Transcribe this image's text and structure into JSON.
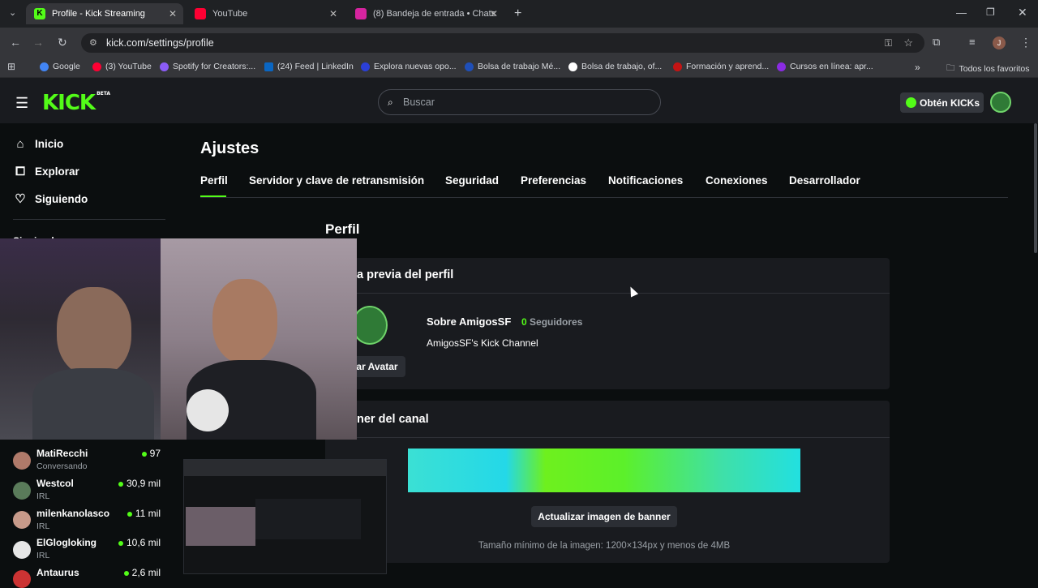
{
  "browser": {
    "tabs": [
      {
        "title": "Profile - Kick Streaming",
        "color": "#53fc18"
      },
      {
        "title": "YouTube",
        "color": "#ff0033"
      },
      {
        "title": "(8) Bandeja de entrada • Chats",
        "color": "#d6249f"
      }
    ],
    "url": "kick.com/settings/profile",
    "bookmarks": [
      {
        "label": "Google",
        "color": "#4285f4"
      },
      {
        "label": "(3) YouTube",
        "color": "#ff0033"
      },
      {
        "label": "Spotify for Creators:...",
        "color": "#8b5cf6"
      },
      {
        "label": "(24) Feed | LinkedIn",
        "color": "#0a66c2"
      },
      {
        "label": "Explora nuevas opo...",
        "color": "#2b3fd6"
      },
      {
        "label": "Bolsa de trabajo Mé...",
        "color": "#1f4fb8"
      },
      {
        "label": "Bolsa de trabajo, of...",
        "color": "#ffffff"
      },
      {
        "label": "Formación y aprend...",
        "color": "#c41414"
      },
      {
        "label": "Cursos en línea: apr...",
        "color": "#8a2be2"
      }
    ],
    "all_bookmarks": "Todos los favoritos"
  },
  "header": {
    "logo": "KICK",
    "logo_badge": "BETA",
    "search_placeholder": "Buscar",
    "kicks_button": "Obtén KICKs"
  },
  "sidebar": {
    "items": [
      {
        "label": "Inicio",
        "icon": "home-icon"
      },
      {
        "label": "Explorar",
        "icon": "compass-icon"
      },
      {
        "label": "Siguiendo",
        "icon": "heart-icon"
      }
    ],
    "partial_label": "Siguiendo",
    "channels": [
      {
        "name": "MatiRecchi",
        "sub": "Conversando",
        "count": "97",
        "color": "#b07a6a"
      },
      {
        "name": "Westcol",
        "sub": "IRL",
        "count": "30,9 mil",
        "color": "#5a7b5a"
      },
      {
        "name": "milenkanolasco",
        "sub": "IRL",
        "count": "11 mil",
        "color": "#c79a8a"
      },
      {
        "name": "ElGlogloking",
        "sub": "IRL",
        "count": "10,6 mil",
        "color": "#e6e6e6"
      },
      {
        "name": "Antaurus",
        "sub": "",
        "count": "2,6 mil",
        "color": "#cc3333"
      }
    ]
  },
  "settings": {
    "title": "Ajustes",
    "tabs": [
      "Perfil",
      "Servidor y clave de retransmisión",
      "Seguridad",
      "Preferencias",
      "Notificaciones",
      "Conexiones",
      "Desarrollador"
    ],
    "section_title": "Perfil",
    "preview_title": "a previa del perfil",
    "about_name": "Sobre AmigosSF",
    "followers_count": "0",
    "followers_label": "Seguidores",
    "channel_desc": "AmigosSF's Kick Channel",
    "avatar_button": "ar Avatar",
    "banner_title": "ner del canal",
    "banner_button": "Actualizar imagen de banner",
    "banner_hint": "Tamaño mínimo de la imagen: 1200×134px y menos de 4MB"
  },
  "colors": {
    "accent": "#53fc18",
    "bg": "#0b0e0f",
    "panel": "#191b1f"
  }
}
